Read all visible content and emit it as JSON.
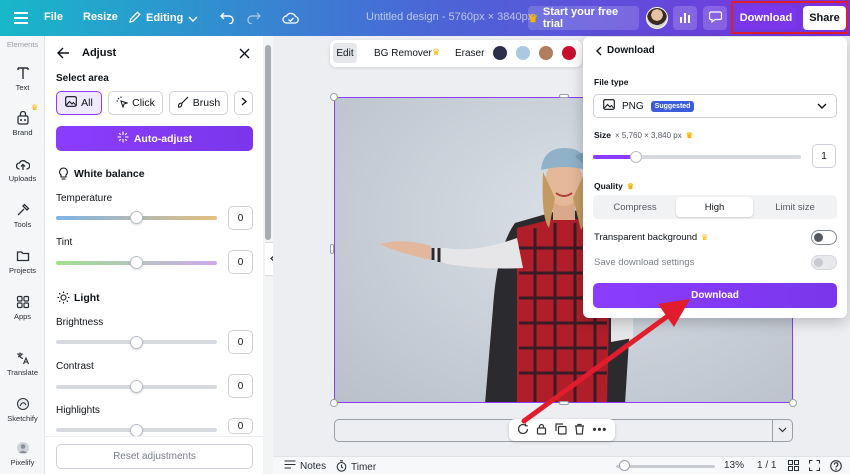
{
  "topbar": {
    "file_label": "File",
    "resize_label": "Resize",
    "mode_label": "Editing",
    "doc_title": "Untitled design - 5760px × 3840px",
    "trial_label": "Start your free trial",
    "download_label": "Download",
    "share_label": "Share"
  },
  "rail": {
    "items": [
      {
        "label": "Elements",
        "icon": "elements-icon"
      },
      {
        "label": "Text",
        "icon": "text-icon"
      },
      {
        "label": "Brand",
        "icon": "brand-icon"
      },
      {
        "label": "Uploads",
        "icon": "uploads-icon"
      },
      {
        "label": "Tools",
        "icon": "tools-icon"
      },
      {
        "label": "Projects",
        "icon": "projects-icon"
      },
      {
        "label": "Apps",
        "icon": "apps-icon"
      },
      {
        "label": "Translate",
        "icon": "translate-icon"
      },
      {
        "label": "Sketchify",
        "icon": "sketchify-icon"
      },
      {
        "label": "Pixelify",
        "icon": "pixelify-icon"
      }
    ]
  },
  "adjust": {
    "title": "Adjust",
    "select_area_label": "Select area",
    "area_options": [
      "All",
      "Click",
      "Brush"
    ],
    "auto_adjust_label": "Auto-adjust",
    "white_balance_label": "White balance",
    "light_label": "Light",
    "sliders": [
      {
        "label": "Temperature",
        "value": "0"
      },
      {
        "label": "Tint",
        "value": "0"
      },
      {
        "label": "Brightness",
        "value": "0"
      },
      {
        "label": "Contrast",
        "value": "0"
      },
      {
        "label": "Highlights",
        "value": "0"
      }
    ],
    "reset_label": "Reset adjustments"
  },
  "context_bar": {
    "edit_label": "Edit",
    "bg_remover_label": "BG Remover",
    "eraser_label": "Eraser",
    "swatches": [
      "#2d2f4a",
      "#a9c9e3",
      "#b07d5e",
      "#c8102e"
    ]
  },
  "download_panel": {
    "title": "Download",
    "file_type_label": "File type",
    "file_type_value": "PNG",
    "suggested_badge": "Suggested",
    "size_label": "Size",
    "size_dims": "× 5,760 × 3,840 px",
    "size_value": "1",
    "quality_label": "Quality",
    "quality_options": [
      "Compress",
      "High",
      "Limit size"
    ],
    "quality_selected": "High",
    "transparent_label": "Transparent background",
    "save_settings_label": "Save download settings",
    "download_button_label": "Download"
  },
  "bottombar": {
    "notes_label": "Notes",
    "timer_label": "Timer",
    "zoom_value": "13%",
    "page_indicator": "1 / 1"
  },
  "colors": {
    "accent": "#8b3dff",
    "highlight_red": "#e11c2c",
    "gradient_start": "#18b7c9",
    "gradient_end": "#7b2fe0"
  }
}
